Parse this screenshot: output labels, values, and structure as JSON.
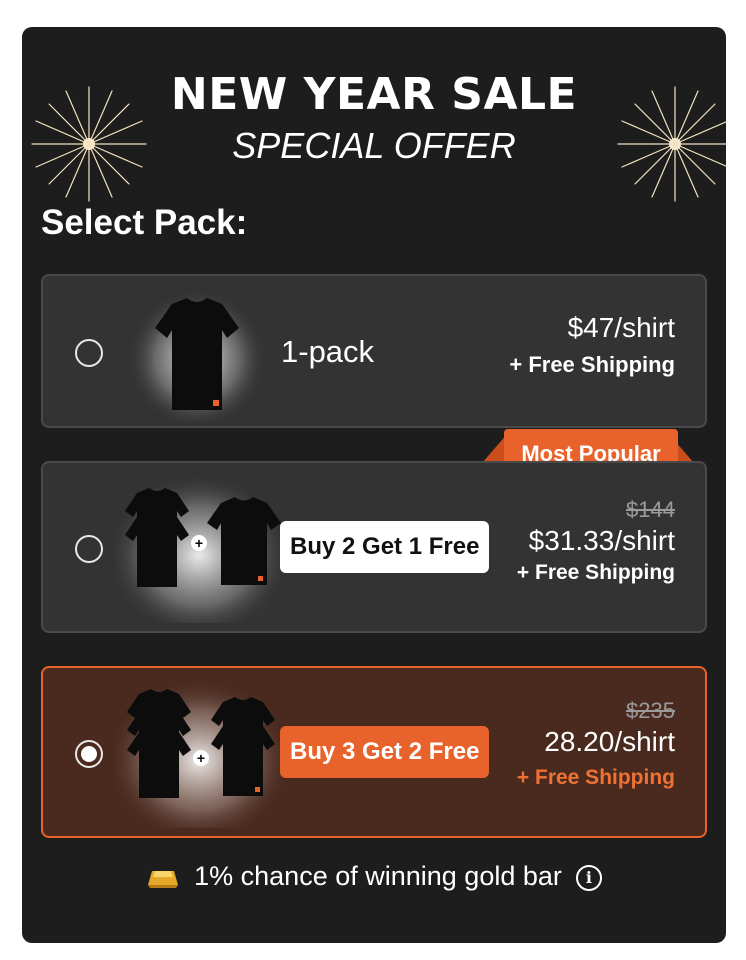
{
  "header": {
    "title": "NEW YEAR SALE",
    "subtitle": "SPECIAL OFFER"
  },
  "select_label": "Select Pack:",
  "packs": [
    {
      "name": "1-pack",
      "old_price": "",
      "price": "$47/shirt",
      "shipping": "+ Free Shipping",
      "selected": false
    },
    {
      "deal": "Buy 2 Get 1 Free",
      "badge": "Most Popular",
      "old_price": "$144",
      "price": "$31.33/shirt",
      "shipping": "+ Free Shipping",
      "selected": false
    },
    {
      "deal": "Buy 3 Get 2 Free",
      "old_price": "$235",
      "price": "28.20/shirt",
      "shipping": "+ Free Shipping",
      "selected": true
    }
  ],
  "footer": {
    "note": "1% chance of winning gold bar"
  },
  "colors": {
    "accent": "#e8632b",
    "background": "#1d1d1d",
    "card": "#333333",
    "selected_card": "#4a2a1f"
  },
  "icons": [
    "firework-icon",
    "shirt-icon",
    "gold-bar-icon",
    "info-icon",
    "radio-icon"
  ]
}
